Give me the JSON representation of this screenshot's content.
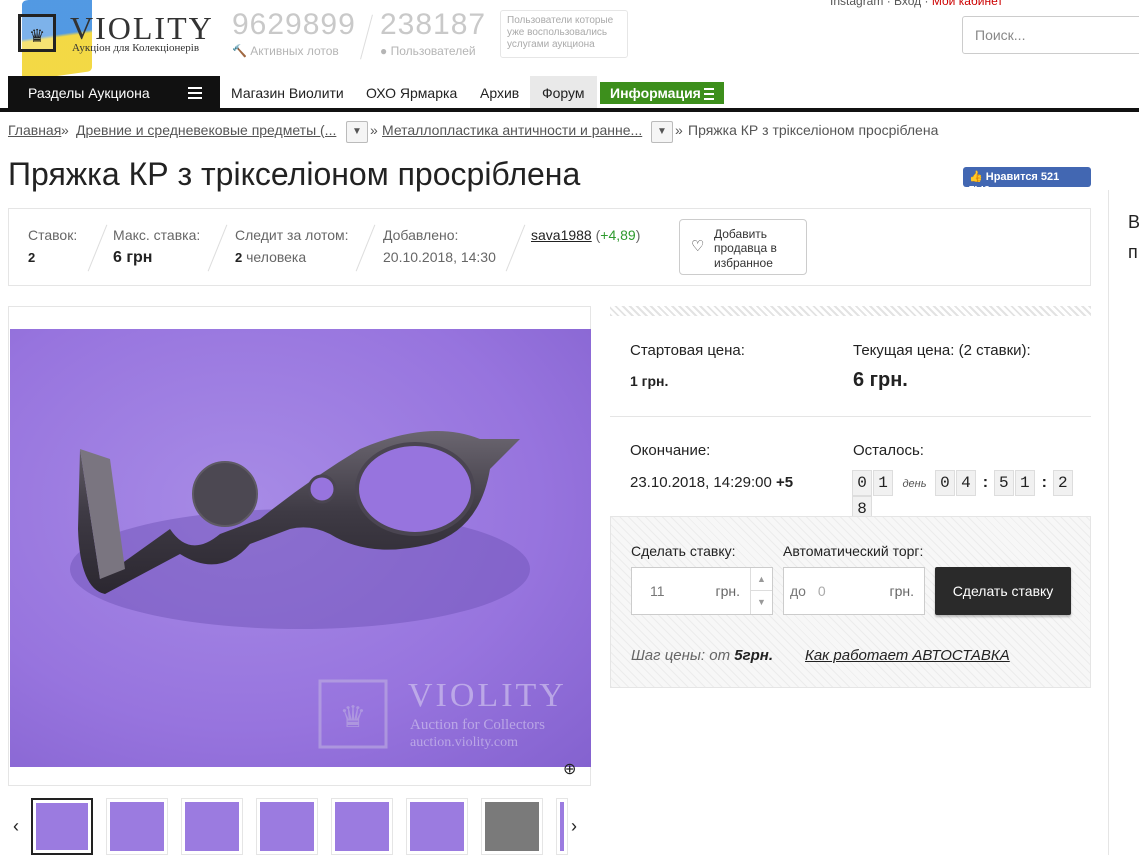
{
  "header": {
    "logo_text": "VIOLITY",
    "logo_sub": "Аукціон для Колекціонерів",
    "active_lots_count": "9629899",
    "active_lots_label": "Активных лотов",
    "users_count": "238187",
    "users_label": "Пользователей",
    "users_note": "Пользователи которые уже воспользовались услугами аукциона",
    "search_placeholder": "Поиск...",
    "top_links": [
      "Instagram",
      "Вход",
      "Мой кабинет"
    ]
  },
  "nav": {
    "sections_label": "Разделы Аукциона",
    "items": [
      "Магазин Виолити",
      "ОХО Ярмарка",
      "Архив",
      "Форум"
    ],
    "info_label": "Информация"
  },
  "breadcrumbs": {
    "home": "Главная",
    "cat1": "Древние и средневековые предметы (...",
    "cat2": "Металлопластика античности и ранне...",
    "current": "Пряжка КР з трікселіоном просріблена"
  },
  "lot": {
    "title": "Пряжка КР з трікселіоном просріблена",
    "fb_like": "Нравится 521 тыс.",
    "bids_label": "Ставок:",
    "bids_value": "2",
    "max_bid_label": "Макс. ставка:",
    "max_bid_value": "6 грн",
    "watchers_label": "Следит за лотом:",
    "watchers_count": "2",
    "watchers_unit": "человека",
    "added_label": "Добавлено:",
    "added_value": "20.10.2018, 14:30",
    "seller": "sava1988",
    "seller_rating": "+4,89",
    "fav_button": "Добавить продавца в избранное"
  },
  "pricing": {
    "start_label": "Стартовая цена:",
    "start_value": "1 грн.",
    "current_label": "Текущая цена: (2 ставки):",
    "current_value": "6 грн.",
    "end_label": "Окончание:",
    "end_value": "23.10.2018, 14:29:00",
    "end_tz": "+5",
    "left_label": "Осталось:",
    "timer_days": [
      "0",
      "1"
    ],
    "timer_day_word": "день",
    "timer_hours": [
      "0",
      "4"
    ],
    "timer_minutes": [
      "5",
      "1"
    ],
    "timer_seconds": [
      "2",
      "8"
    ],
    "bid_label": "Сделать ставку:",
    "bid_value": "11",
    "currency": "грн.",
    "auto_label": "Автоматический торг:",
    "auto_prefix": "до",
    "auto_placeholder": "0",
    "bid_button": "Сделать ставку",
    "step_label": "Шаг цены:",
    "step_from": "от",
    "step_value": "5грн.",
    "auto_link": "Как работает АВТОСТАВКА"
  },
  "image": {
    "watermark": "VIOLITY",
    "watermark_sub": "Auction for Collectors",
    "watermark_url": "auction.violity.com"
  },
  "colors": {
    "accent_green": "#3d8f1c",
    "photo_bg": "#9774de",
    "button_dark": "#2a2a2a",
    "fb_blue": "#4267b2"
  }
}
